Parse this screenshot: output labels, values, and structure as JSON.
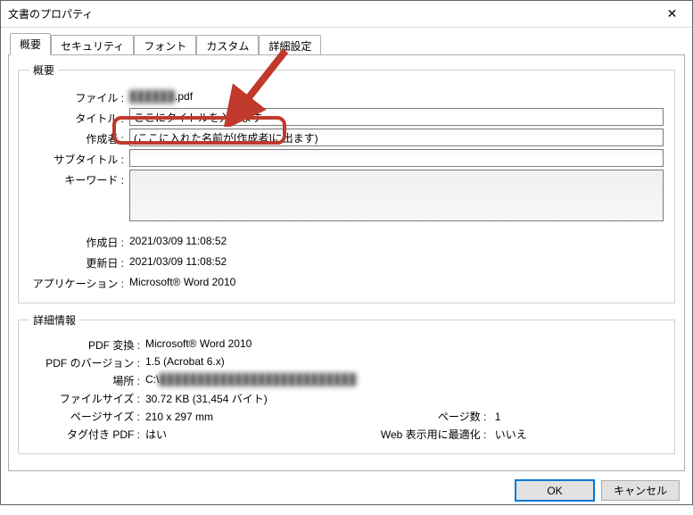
{
  "window": {
    "title": "文書のプロパティ",
    "close_glyph": "✕"
  },
  "tabs": {
    "summary": "概要",
    "security": "セキュリティ",
    "fonts": "フォント",
    "custom": "カスタム",
    "advanced": "詳細設定"
  },
  "summary": {
    "legend": "概要",
    "labels": {
      "file": "ファイル :",
      "title": "タイトル :",
      "author": "作成者 :",
      "subtitle": "サブタイトル :",
      "keywords": "キーワード :",
      "created": "作成日 :",
      "modified": "更新日 :",
      "application": "アプリケーション :"
    },
    "values": {
      "file_prefix_hidden": "██████",
      "file_suffix": ".pdf",
      "title": "ここにタイトルを入れます",
      "author": "(ここに入れた名前が[作成者]に出ます)",
      "subtitle": "",
      "keywords": "",
      "created": "2021/03/09 11:08:52",
      "modified": "2021/03/09 11:08:52",
      "application": "Microsoft® Word 2010"
    }
  },
  "detail": {
    "legend": "詳細情報",
    "labels": {
      "pdf_producer": "PDF 変換 :",
      "pdf_version": "PDF のバージョン :",
      "location": "場所 :",
      "filesize": "ファイルサイズ :",
      "pagesize": "ページサイズ :",
      "pagecount": "ページ数 :",
      "tagged": "タグ付き PDF :",
      "fastweb": "Web 表示用に最適化 :"
    },
    "values": {
      "pdf_producer": "Microsoft® Word 2010",
      "pdf_version": "1.5 (Acrobat 6.x)",
      "location_prefix": "C:\\",
      "location_hidden": "██████████████████████████",
      "filesize": "30.72 KB (31,454 バイト)",
      "pagesize": "210 x 297 mm",
      "pagecount": "1",
      "tagged": "はい",
      "fastweb": "いいえ"
    }
  },
  "buttons": {
    "ok": "OK",
    "cancel": "キャンセル"
  }
}
